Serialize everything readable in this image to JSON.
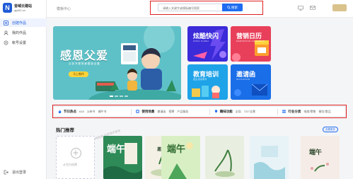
{
  "sidebar": {
    "brand_mark": "N",
    "brand_name": "音域云建站",
    "brand_domain": "qiyi92.cn",
    "items": [
      {
        "label": "创建作品",
        "icon": "create-icon",
        "active": true
      },
      {
        "label": "我的作品",
        "icon": "works-icon",
        "active": false
      },
      {
        "label": "帐号设置",
        "icon": "settings-icon",
        "active": false
      }
    ],
    "logout_label": "退出登录"
  },
  "topbar": {
    "breadcrumb": "模板中心",
    "search": {
      "placeholder": "请输入关键字或模板编号搜索",
      "button_label": "搜索"
    }
  },
  "banner": {
    "title": "感恩父爱",
    "subtitle": "父 亲 节 微 场 景 模 版 合 集",
    "button_label": "马上制作"
  },
  "promo_cards": [
    {
      "title": "炫酷快闪",
      "subtitle": "COOL FLASH",
      "color": "#3b2bd8"
    },
    {
      "title": "营销日历",
      "subtitle": "MARKETING CALENDAR",
      "color": "#e8405a"
    },
    {
      "title": "教育培训",
      "subtitle": "招生培训教育",
      "color": "#1ea3e8"
    },
    {
      "title": "邀请函",
      "subtitle": "INVITATION",
      "color": "#1a6ee8"
    }
  ],
  "filters": [
    {
      "heading": "节日热点",
      "icon": "fire-icon",
      "items": [
        "618",
        "父亲节",
        "端午节"
      ]
    },
    {
      "heading": "使用场景",
      "icon": "scene-icon",
      "items": [
        "邀请函",
        "招聘",
        "产品服务"
      ]
    },
    {
      "heading": "趣味功能",
      "icon": "fun-icon",
      "items": [
        "全局",
        "720°全景"
      ]
    },
    {
      "heading": "行业分类",
      "icon": "industry-icon",
      "items": [
        "电商/零售",
        "餐饮/食品"
      ]
    }
  ],
  "hot": {
    "title": "热门推荐",
    "more_label": "查看更多",
    "blank_label": "从空白创建",
    "watermark": "辣鸡数据 仅供演示使用",
    "tiles": [
      {
        "text": "",
        "bg": "#ffffff"
      },
      {
        "text": "端午",
        "bg": "#2e8b57"
      },
      {
        "text": "邀请函",
        "bg": "#f4f0e6"
      },
      {
        "text": "端午",
        "bg": "#d8efc4"
      },
      {
        "text": "",
        "bg": "#e9efe0"
      },
      {
        "text": "",
        "bg": "#e8f3f7"
      },
      {
        "text": "端午",
        "bg": "#f6ece7"
      }
    ]
  },
  "colors": {
    "primary": "#1f6cf0",
    "highlight_box": "#e02020",
    "banner_bg": "#5fc1c8"
  }
}
